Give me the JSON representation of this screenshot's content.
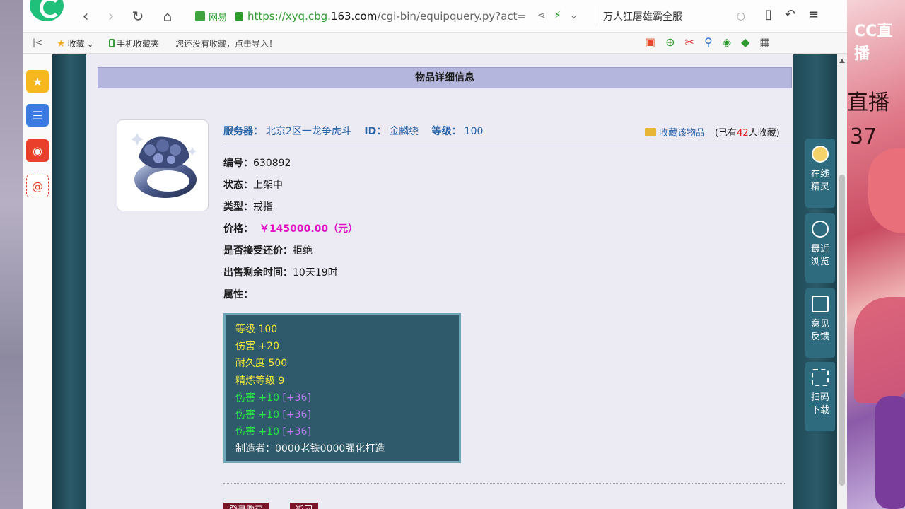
{
  "browser": {
    "site_name": "网易",
    "url_scheme": "https://",
    "url_host_prefix": "xyq.cbg.",
    "url_host_bold": "163.com",
    "url_path": "/cgi-bin/equipquery.py?act=",
    "search_text": "万人狂屠雄霸全服"
  },
  "bookmarks": {
    "favorites_label": "收藏",
    "mobile_label": "手机收藏夹",
    "hint": "您还没有收藏，点击导入！"
  },
  "page": {
    "title": "物品详细信息",
    "server_label": "服务器：",
    "server_value": "北京2区一龙争虎斗",
    "id_label": "ID：",
    "id_value": "金麟绕",
    "level_label": "等级：",
    "level_value": "100",
    "fav_button": "收藏该物品",
    "fav_count_prefix": "(已有",
    "fav_count": "42",
    "fav_count_suffix": "人收藏)",
    "rows": [
      {
        "k": "编号：",
        "v": "630892"
      },
      {
        "k": "状态：",
        "v": "上架中"
      },
      {
        "k": "类型：",
        "v": "戒指"
      },
      {
        "k": "价格：",
        "v": "￥145000.00（元）"
      },
      {
        "k": "是否接受还价：",
        "v": "拒绝"
      },
      {
        "k": "出售剩余时间：",
        "v": "10天19时"
      },
      {
        "k": "属性：",
        "v": ""
      }
    ],
    "attrs": [
      {
        "text": "等级 100",
        "extra": ""
      },
      {
        "text": "伤害 +20",
        "extra": ""
      },
      {
        "text": "耐久度 500",
        "extra": ""
      },
      {
        "text": "精炼等级 9",
        "extra": ""
      },
      {
        "text": "伤害 +10",
        "extra": "[+36]"
      },
      {
        "text": "伤害 +10",
        "extra": "[+36]"
      },
      {
        "text": "伤害 +10",
        "extra": "[+36]"
      },
      {
        "text": "制造者：0000老铁0000强化打造",
        "extra": ""
      }
    ],
    "btn_login": "登录购买",
    "btn_back": "返回"
  },
  "float_panel": [
    {
      "label": "在线精灵",
      "icon": "avatar-icon"
    },
    {
      "label": "最近浏览",
      "icon": "clock-icon"
    },
    {
      "label": "意见反馈",
      "icon": "edit-icon"
    },
    {
      "label": "扫码下载",
      "icon": "scan-icon"
    }
  ],
  "overlay": {
    "live_brand": "CC直播",
    "live_text": "直播",
    "number": "37"
  },
  "colors": {
    "price": "#e012c8",
    "server_blue": "#2763a8",
    "attr_yellow": "#f2e83a",
    "attr_green": "#2fe24a",
    "header_bg": "#b4b6de"
  }
}
